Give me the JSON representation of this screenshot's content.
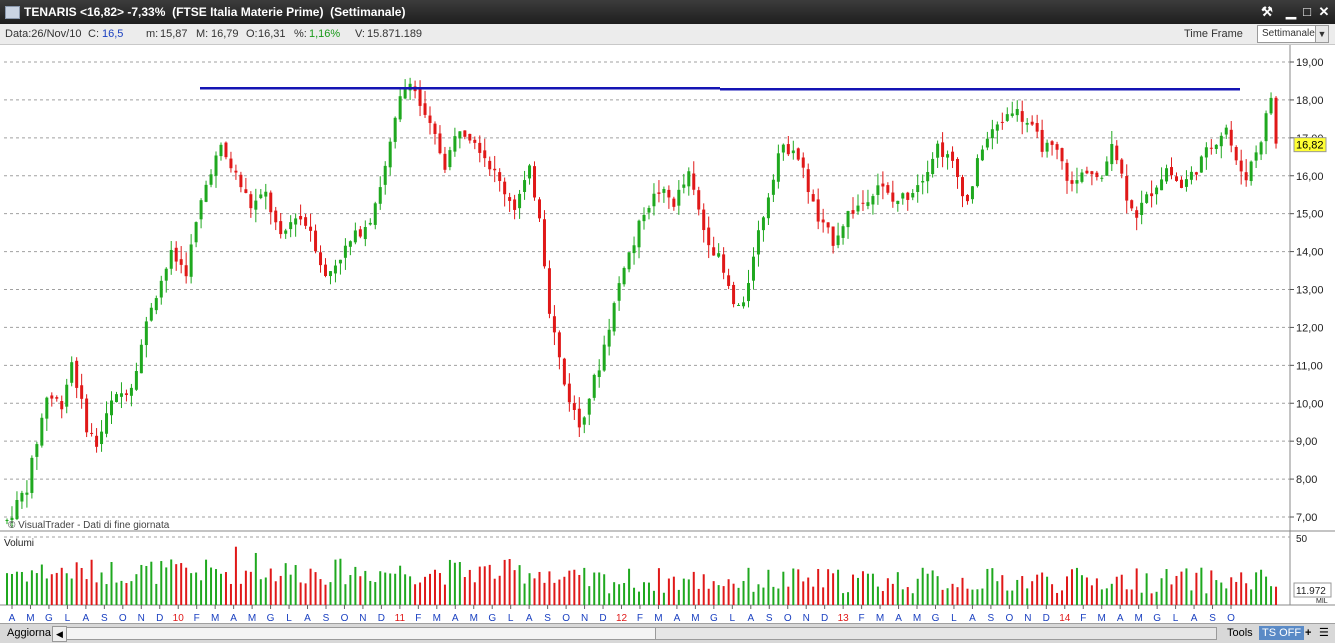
{
  "window": {
    "title": "TENARIS <16,82> -7,33%  (FTSE Italia Materie Prime)  (Settimanale)",
    "buttons": [
      "⚒",
      "▁",
      "□",
      "✕"
    ]
  },
  "infobar": {
    "data": "Data:26/Nov/10",
    "close_label": "C:",
    "close_value": "16,5",
    "min_label": "m:",
    "min_value": "15,87",
    "max_label": "M:",
    "max_value": "16,79",
    "open_label": "O:",
    "open_value": "16,31",
    "pct_label": "%:",
    "pct_value": "1,16%",
    "vol_label": "V:",
    "vol_value": "15.871.189",
    "timeframe_label": "Time Frame",
    "timeframe_value": "Settimanale"
  },
  "chart_data": {
    "type": "candlestick",
    "title": "TENARIS",
    "subtitle": "FTSE Italia Materie Prime - Settimanale",
    "watermark": "© VisualTrader - Dati di fine giornata",
    "y_ticks": [
      "19,00",
      "18,00",
      "17,00",
      "16,00",
      "15,00",
      "14,00",
      "13,00",
      "12,00",
      "11,00",
      "10,00",
      "9,00",
      "8,00",
      "7,00"
    ],
    "ylim": [
      6.6,
      19.4
    ],
    "last_price": "16,82",
    "resistance_level": 18.28,
    "volume_panel_label": "Volumi",
    "volume_ticks": [
      "50"
    ],
    "volume_last": "11.972",
    "volume_unit": "MIL",
    "x_month_labels": [
      "A",
      "M",
      "G",
      "L",
      "A",
      "S",
      "O",
      "N",
      "D",
      "10",
      "F",
      "M",
      "A",
      "M",
      "G",
      "L",
      "A",
      "S",
      "O",
      "N",
      "D",
      "11",
      "F",
      "M",
      "A",
      "M",
      "G",
      "L",
      "A",
      "S",
      "O",
      "N",
      "D",
      "12",
      "F",
      "M",
      "A",
      "M",
      "G",
      "L",
      "A",
      "S",
      "O",
      "N",
      "D",
      "13",
      "F",
      "M",
      "A",
      "M",
      "G",
      "L",
      "A",
      "S",
      "O",
      "N",
      "D",
      "14",
      "F",
      "M",
      "A",
      "M",
      "G",
      "L",
      "A",
      "S",
      "O"
    ],
    "year_labels": [
      "10",
      "11",
      "12",
      "13",
      "14"
    ],
    "price_path": [
      [
        0,
        6.9
      ],
      [
        4,
        7.8
      ],
      [
        8,
        10.2
      ],
      [
        11,
        10.0
      ],
      [
        13,
        11.1
      ],
      [
        16,
        9.4
      ],
      [
        18,
        8.9
      ],
      [
        21,
        10.0
      ],
      [
        25,
        10.5
      ],
      [
        29,
        12.6
      ],
      [
        33,
        13.9
      ],
      [
        36,
        13.5
      ],
      [
        39,
        15.3
      ],
      [
        41,
        16.2
      ],
      [
        43,
        16.7
      ],
      [
        46,
        16.0
      ],
      [
        49,
        15.2
      ],
      [
        52,
        15.5
      ],
      [
        55,
        14.3
      ],
      [
        58,
        15.0
      ],
      [
        61,
        14.6
      ],
      [
        64,
        13.3
      ],
      [
        67,
        13.9
      ],
      [
        70,
        14.4
      ],
      [
        73,
        14.9
      ],
      [
        76,
        16.2
      ],
      [
        79,
        18.0
      ],
      [
        81,
        18.6
      ],
      [
        84,
        17.5
      ],
      [
        86,
        17.0
      ],
      [
        88,
        16.3
      ],
      [
        91,
        17.3
      ],
      [
        94,
        17.0
      ],
      [
        97,
        16.3
      ],
      [
        99,
        15.8
      ],
      [
        102,
        15.2
      ],
      [
        105,
        16.1
      ],
      [
        107,
        15.0
      ],
      [
        109,
        12.5
      ],
      [
        112,
        10.5
      ],
      [
        115,
        9.4
      ],
      [
        117,
        10.2
      ],
      [
        119,
        11.0
      ],
      [
        122,
        12.6
      ],
      [
        124,
        13.7
      ],
      [
        126,
        14.2
      ],
      [
        128,
        15.1
      ],
      [
        131,
        15.6
      ],
      [
        134,
        15.3
      ],
      [
        137,
        16.0
      ],
      [
        140,
        14.6
      ],
      [
        143,
        13.8
      ],
      [
        146,
        12.6
      ],
      [
        148,
        12.5
      ],
      [
        150,
        14.0
      ],
      [
        152,
        15.0
      ],
      [
        155,
        16.6
      ],
      [
        158,
        16.8
      ],
      [
        160,
        16.1
      ],
      [
        163,
        14.8
      ],
      [
        166,
        14.3
      ],
      [
        169,
        15.0
      ],
      [
        172,
        15.3
      ],
      [
        175,
        15.8
      ],
      [
        178,
        15.3
      ],
      [
        181,
        15.5
      ],
      [
        184,
        16.0
      ],
      [
        187,
        16.8
      ],
      [
        190,
        16.3
      ],
      [
        193,
        15.3
      ],
      [
        196,
        16.8
      ],
      [
        199,
        17.3
      ],
      [
        202,
        17.8
      ],
      [
        205,
        17.4
      ],
      [
        208,
        16.8
      ],
      [
        211,
        16.6
      ],
      [
        214,
        15.7
      ],
      [
        217,
        16.2
      ],
      [
        220,
        15.8
      ],
      [
        222,
        17.0
      ],
      [
        225,
        15.5
      ],
      [
        227,
        15.0
      ],
      [
        230,
        15.6
      ],
      [
        233,
        16.2
      ],
      [
        236,
        15.7
      ],
      [
        239,
        16.2
      ],
      [
        242,
        16.8
      ],
      [
        245,
        17.3
      ],
      [
        247,
        16.3
      ],
      [
        249,
        16.0
      ],
      [
        252,
        17.0
      ],
      [
        254,
        18.1
      ],
      [
        255,
        16.82
      ]
    ]
  },
  "bottombar": {
    "refresh": "Aggiorna",
    "tools": "Tools",
    "ts": "TS OFF",
    "plus": "+",
    "menu": "☰"
  },
  "colors": {
    "up": "#1fa81f",
    "down": "#e01818",
    "resistance": "#1414b4",
    "grid": "#a0a0a0",
    "price_tag": "#ffff33",
    "month_label": "#1a40c0",
    "year_label": "#e01818"
  }
}
